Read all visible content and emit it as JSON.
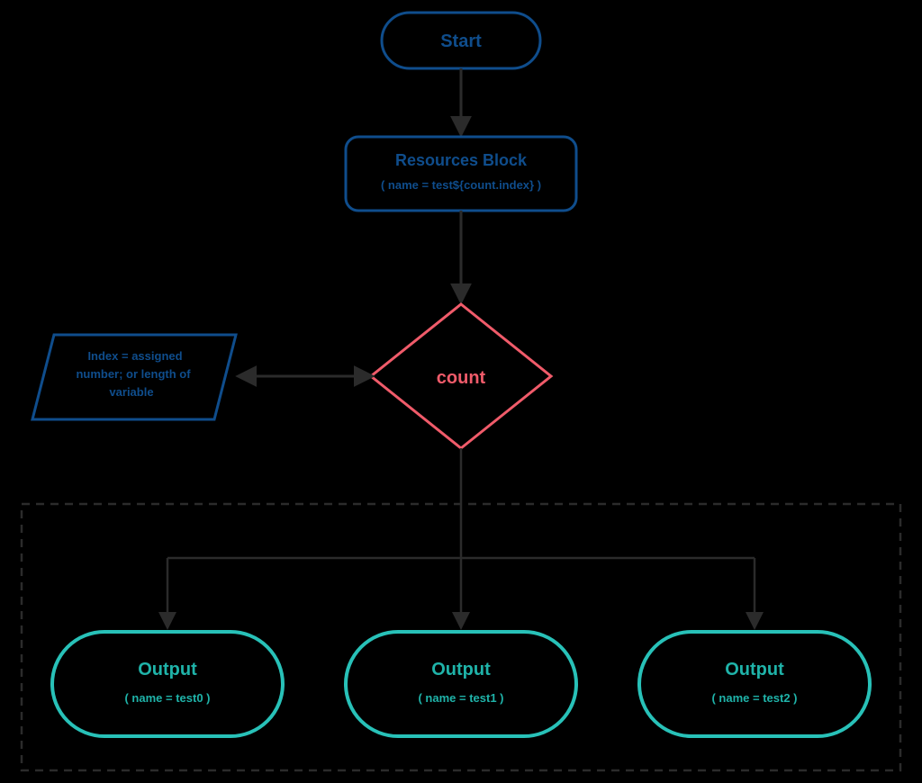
{
  "colors": {
    "blue": "#0f4d8c",
    "teal": "#28c1b8",
    "red": "#f05b6a",
    "dark": "#2b2b2b",
    "text_teal": "#1fb3a9"
  },
  "start": {
    "label": "Start"
  },
  "resources": {
    "title": "Resources Block",
    "sub": "( name = test${count.index} )"
  },
  "decision": {
    "label": "count"
  },
  "note": {
    "line1": "Index = assigned",
    "line2": "number; or length of",
    "line3": "variable"
  },
  "outputs": [
    {
      "title": "Output",
      "sub": "( name = test0 )"
    },
    {
      "title": "Output",
      "sub": "( name = test1 )"
    },
    {
      "title": "Output",
      "sub": "( name = test2 )"
    }
  ]
}
